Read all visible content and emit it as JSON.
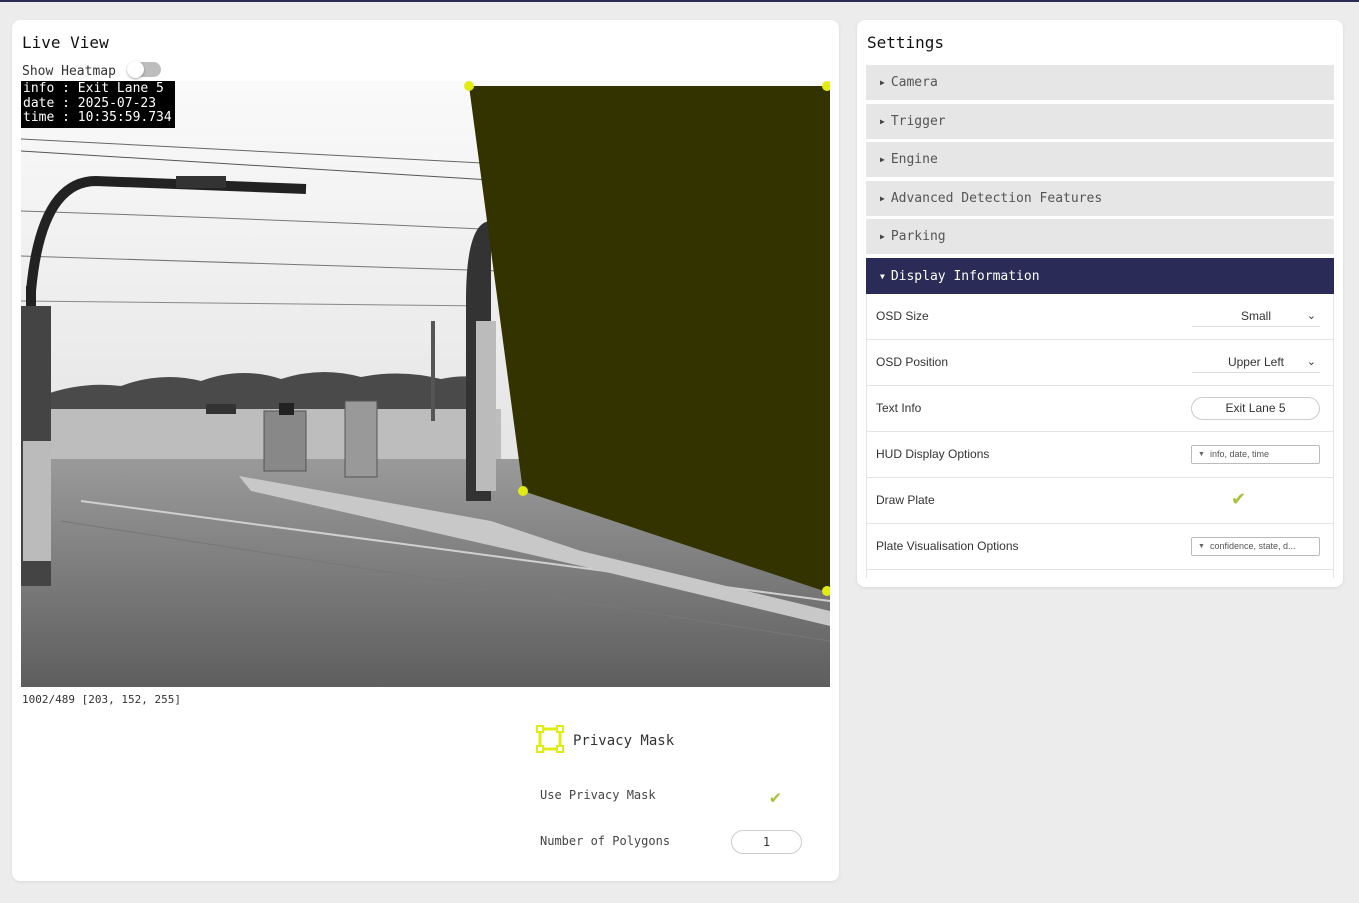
{
  "live_view": {
    "title": "Live View",
    "heatmap_label": "Show Heatmap",
    "heatmap_on": false,
    "osd": {
      "line1": "info : Exit Lane 5",
      "line2": "date : 2025-07-23",
      "line3": "time : 10:35:59.734"
    },
    "pixel_readout": "1002/489 [203, 152, 255]",
    "mask_color": "#333300",
    "handle_color": "#e1ec15"
  },
  "privacy_mask": {
    "title": "Privacy Mask",
    "use_label": "Use Privacy Mask",
    "use_enabled": true,
    "polygons_label": "Number of Polygons",
    "polygons_value": "1",
    "icon": "polygon-select-icon",
    "accent_color": "#e1ec15"
  },
  "settings": {
    "title": "Settings",
    "sections": [
      {
        "label": "Camera",
        "expanded": false
      },
      {
        "label": "Trigger",
        "expanded": false
      },
      {
        "label": "Engine",
        "expanded": false
      },
      {
        "label": "Advanced Detection Features",
        "expanded": false
      },
      {
        "label": "Parking",
        "expanded": false
      },
      {
        "label": "Display Information",
        "expanded": true
      }
    ],
    "display_information": {
      "osd_size": {
        "label": "OSD Size",
        "value": "Small"
      },
      "osd_position": {
        "label": "OSD Position",
        "value": "Upper Left"
      },
      "text_info": {
        "label": "Text Info",
        "value": "Exit Lane 5"
      },
      "hud_options": {
        "label": "HUD Display Options",
        "value": "info, date, time"
      },
      "draw_plate": {
        "label": "Draw Plate",
        "enabled": true
      },
      "plate_vis": {
        "label": "Plate Visualisation Options",
        "value": "confidence, state, d..."
      }
    },
    "active_color": "#2b2b57",
    "check_color": "#a7c43a"
  }
}
